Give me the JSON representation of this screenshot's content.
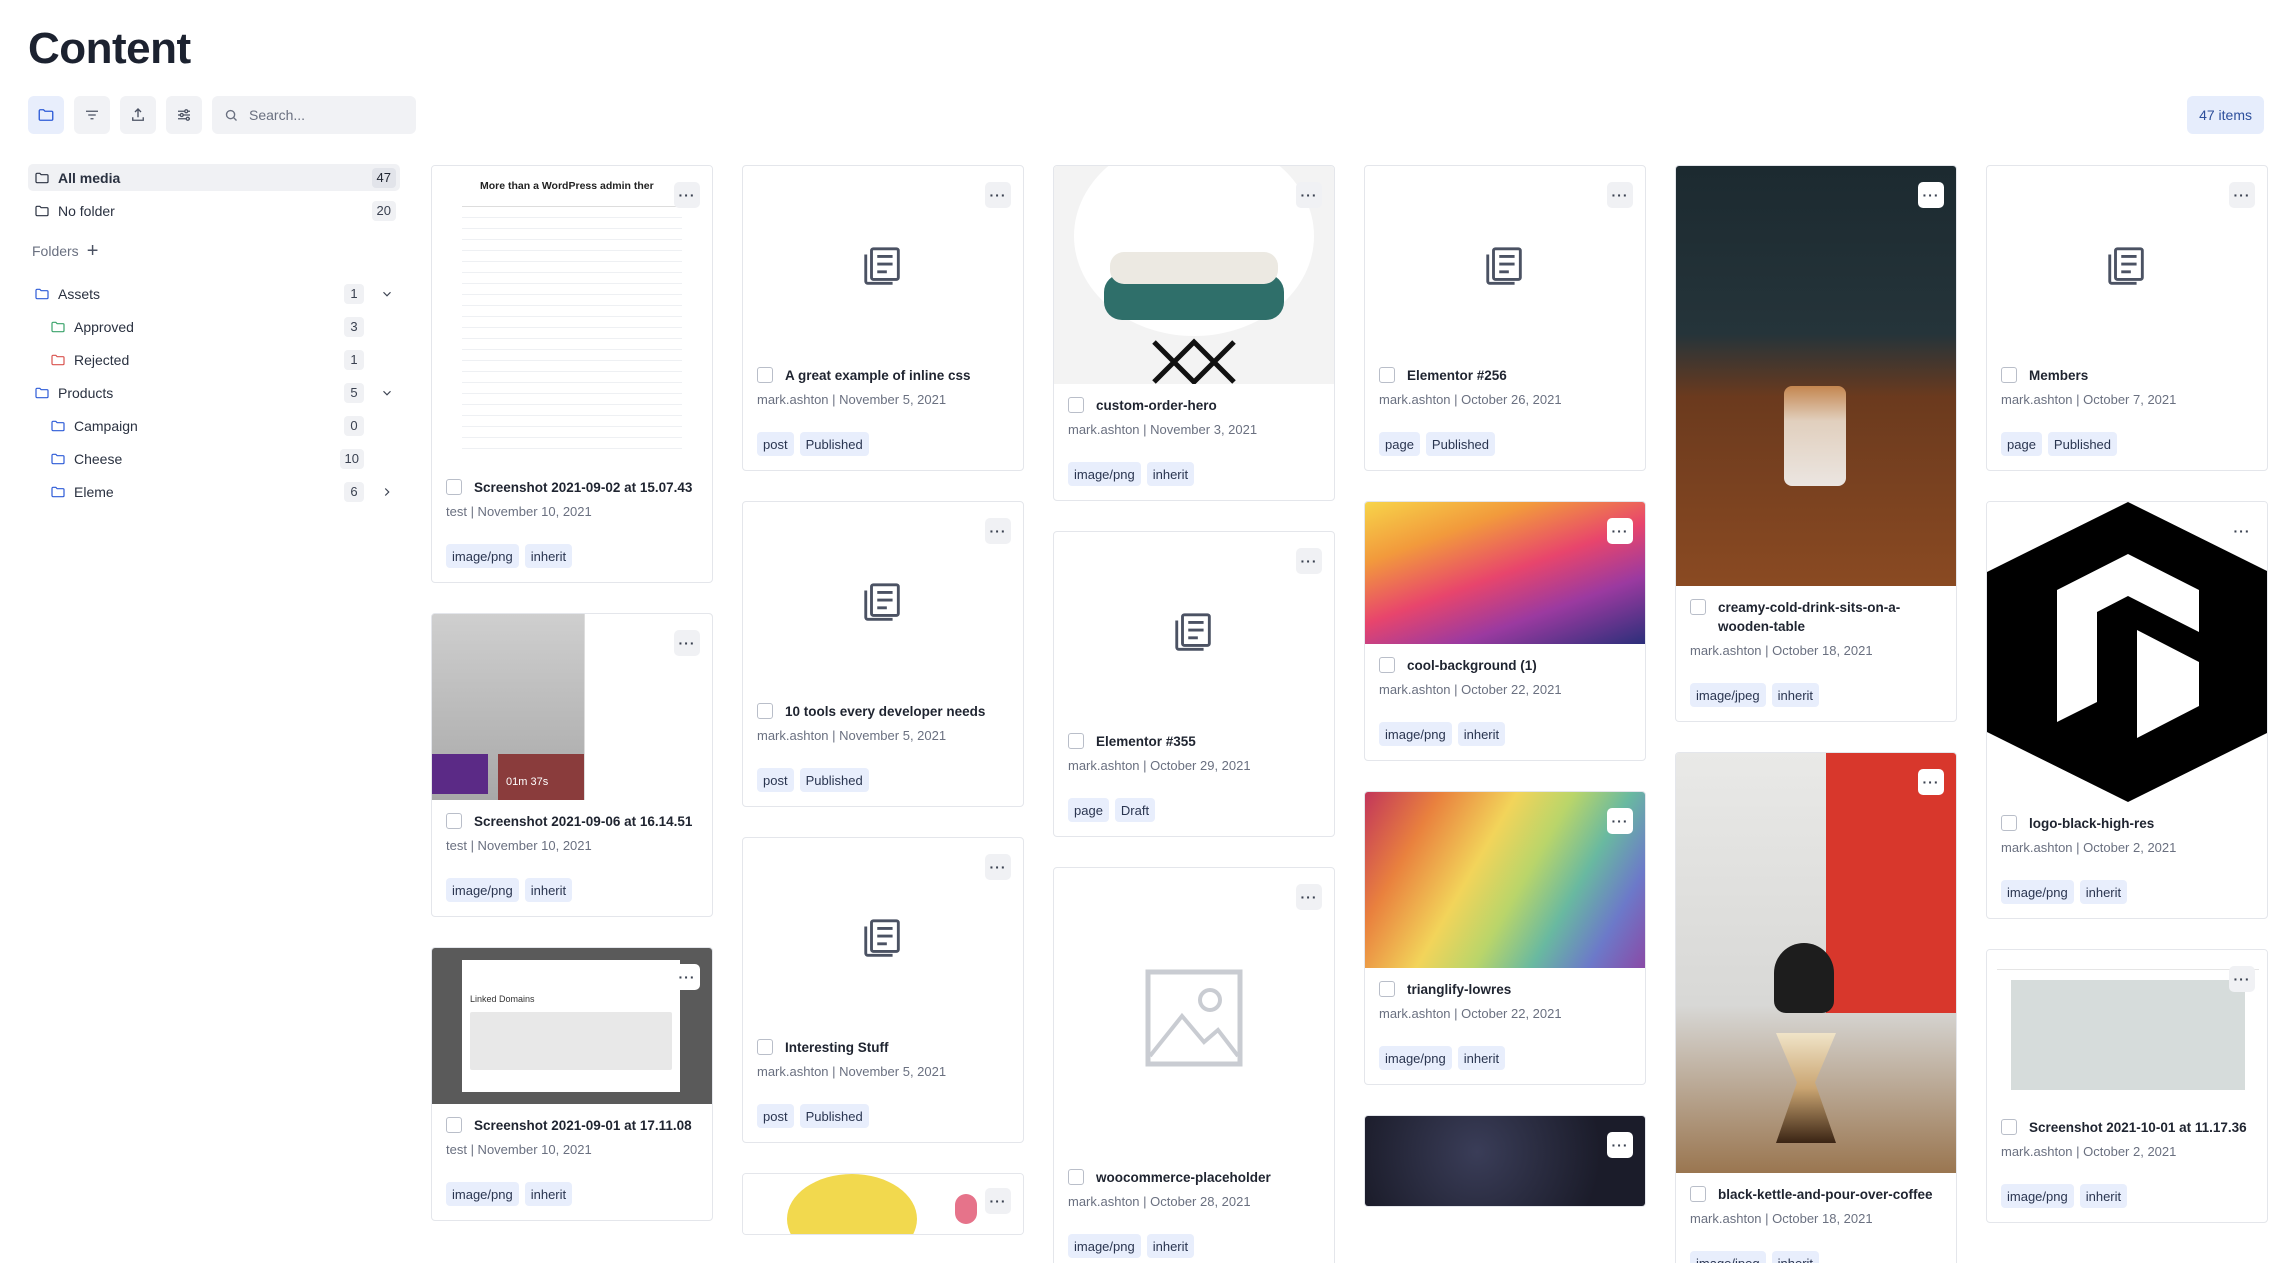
{
  "header": {
    "title": "Content",
    "items_count": "47 items"
  },
  "toolbar": {
    "search_placeholder": "Search..."
  },
  "sidebar": {
    "all_media": {
      "label": "All media",
      "count": "47"
    },
    "no_folder": {
      "label": "No folder",
      "count": "20"
    },
    "folders_label": "Folders",
    "folders": [
      {
        "label": "Assets",
        "count": "1"
      },
      {
        "label": "Approved",
        "count": "3"
      },
      {
        "label": "Rejected",
        "count": "1"
      },
      {
        "label": "Products",
        "count": "5"
      },
      {
        "label": "Campaign",
        "count": "0"
      },
      {
        "label": "Cheese",
        "count": "10"
      },
      {
        "label": "Eleme",
        "count": "6"
      }
    ]
  },
  "colors": {
    "accent": "#2d5bd7",
    "tag_bg": "#e8eefc",
    "folder_green": "#3aa36b",
    "folder_red": "#d9534f"
  },
  "cards": [
    {
      "title": "Screenshot 2021-09-02 at 15.07.43",
      "meta": "test | November 10, 2021",
      "tags": [
        "image/png",
        "inherit"
      ],
      "thumb_text": "More than a WordPress admin ther"
    },
    {
      "title": "Screenshot 2021-09-06 at 16.14.51",
      "meta": "test | November 10, 2021",
      "tags": [
        "image/png",
        "inherit"
      ],
      "thumb_text": "01m 37s"
    },
    {
      "title": "Screenshot 2021-09-01 at 17.11.08",
      "meta": "test | November 10, 2021",
      "tags": [
        "image/png",
        "inherit"
      ],
      "thumb_text": "Linked Domains"
    },
    {
      "title": "A great example of inline css",
      "meta": "mark.ashton | November 5, 2021",
      "tags": [
        "post",
        "Published"
      ]
    },
    {
      "title": "10 tools every developer needs",
      "meta": "mark.ashton | November 5, 2021",
      "tags": [
        "post",
        "Published"
      ]
    },
    {
      "title": "Interesting Stuff",
      "meta": "mark.ashton | November 5, 2021",
      "tags": [
        "post",
        "Published"
      ]
    },
    {
      "title": "custom-order-hero",
      "meta": "mark.ashton | November 3, 2021",
      "tags": [
        "image/png",
        "inherit"
      ]
    },
    {
      "title": "Elementor #355",
      "meta": "mark.ashton | October 29, 2021",
      "tags": [
        "page",
        "Draft"
      ]
    },
    {
      "title": "woocommerce-placeholder",
      "meta": "mark.ashton | October 28, 2021",
      "tags": [
        "image/png",
        "inherit"
      ]
    },
    {
      "title": "Elementor #256",
      "meta": "mark.ashton | October 26, 2021",
      "tags": [
        "page",
        "Published"
      ]
    },
    {
      "title": "cool-background (1)",
      "meta": "mark.ashton | October 22, 2021",
      "tags": [
        "image/png",
        "inherit"
      ]
    },
    {
      "title": "trianglify-lowres",
      "meta": "mark.ashton | October 22, 2021",
      "tags": [
        "image/png",
        "inherit"
      ]
    },
    {
      "title": "creamy-cold-drink-sits-on-a-wooden-table",
      "meta": "mark.ashton | October 18, 2021",
      "tags": [
        "image/jpeg",
        "inherit"
      ]
    },
    {
      "title": "black-kettle-and-pour-over-coffee",
      "meta": "mark.ashton | October 18, 2021",
      "tags": [
        "image/jpeg",
        "inherit"
      ]
    },
    {
      "title": "Members",
      "meta": "mark.ashton | October 7, 2021",
      "tags": [
        "page",
        "Published"
      ]
    },
    {
      "title": "logo-black-high-res",
      "meta": "mark.ashton | October 2, 2021",
      "tags": [
        "image/png",
        "inherit"
      ]
    },
    {
      "title": "Screenshot 2021-10-01 at 11.17.36",
      "meta": "mark.ashton | October 2, 2021",
      "tags": [
        "image/png",
        "inherit"
      ]
    }
  ]
}
